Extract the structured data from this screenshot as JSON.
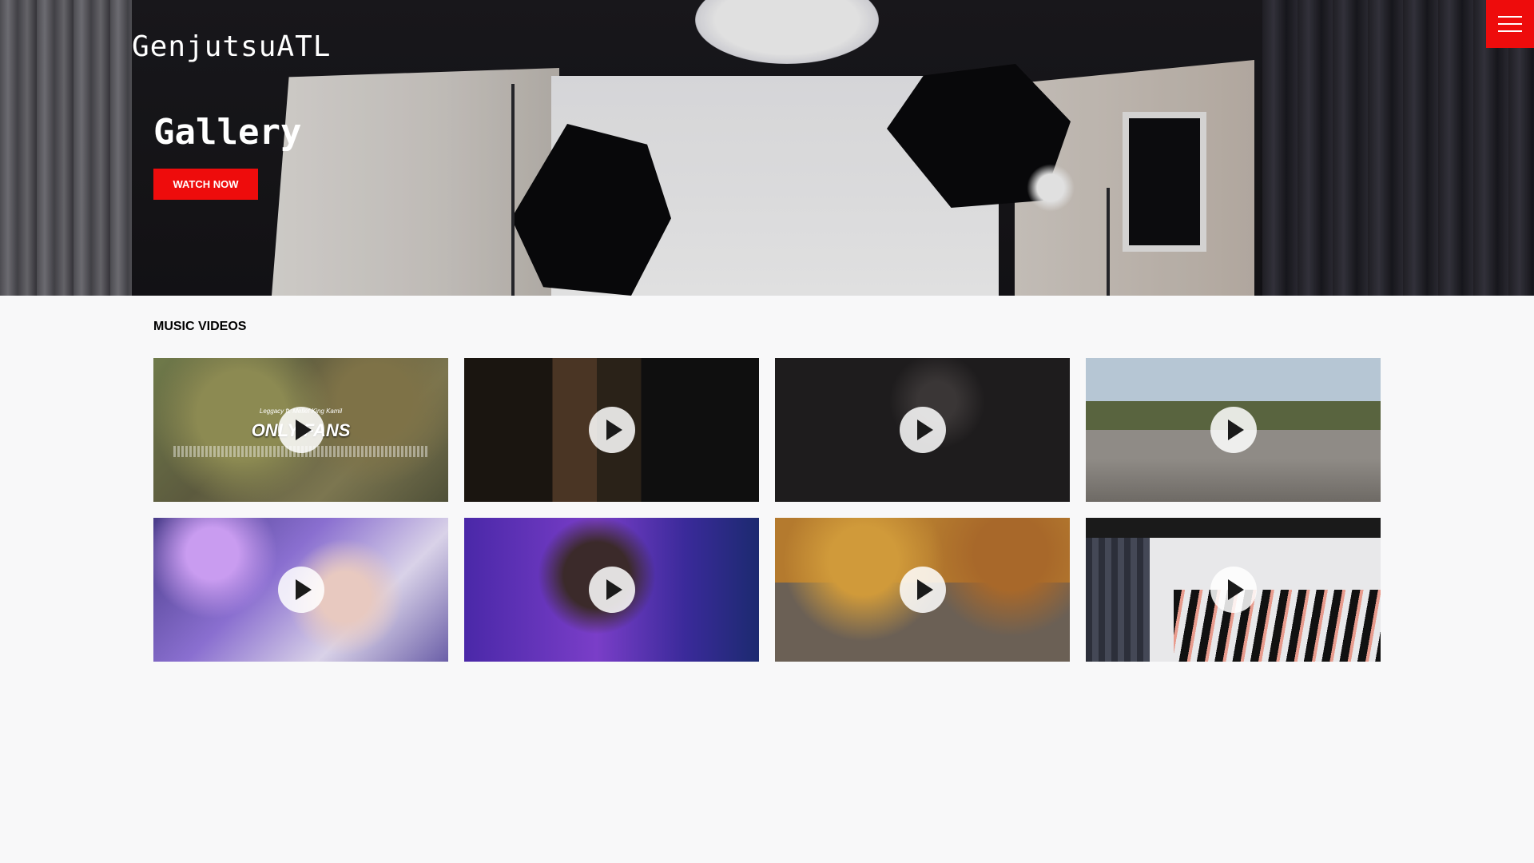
{
  "header": {
    "brand": "GenjutsuATL",
    "menu_icon": "hamburger-icon"
  },
  "hero": {
    "title": "Gallery",
    "cta_label": "WATCH NOW"
  },
  "section": {
    "title": "MUSIC VIDEOS"
  },
  "videos": [
    {
      "overlay_subtitle": "Leggacy ft. Mellef King Kamil",
      "overlay_title": "ONLY FANS",
      "icon": "play-icon"
    },
    {
      "icon": "play-icon"
    },
    {
      "icon": "play-icon"
    },
    {
      "icon": "play-icon"
    },
    {
      "icon": "play-icon"
    },
    {
      "icon": "play-icon"
    },
    {
      "icon": "play-icon"
    },
    {
      "icon": "play-icon"
    }
  ],
  "colors": {
    "accent": "#ee0c0c",
    "page_background": "#f8f8f9",
    "text_light": "#ffffff",
    "text_dark": "#000000"
  }
}
